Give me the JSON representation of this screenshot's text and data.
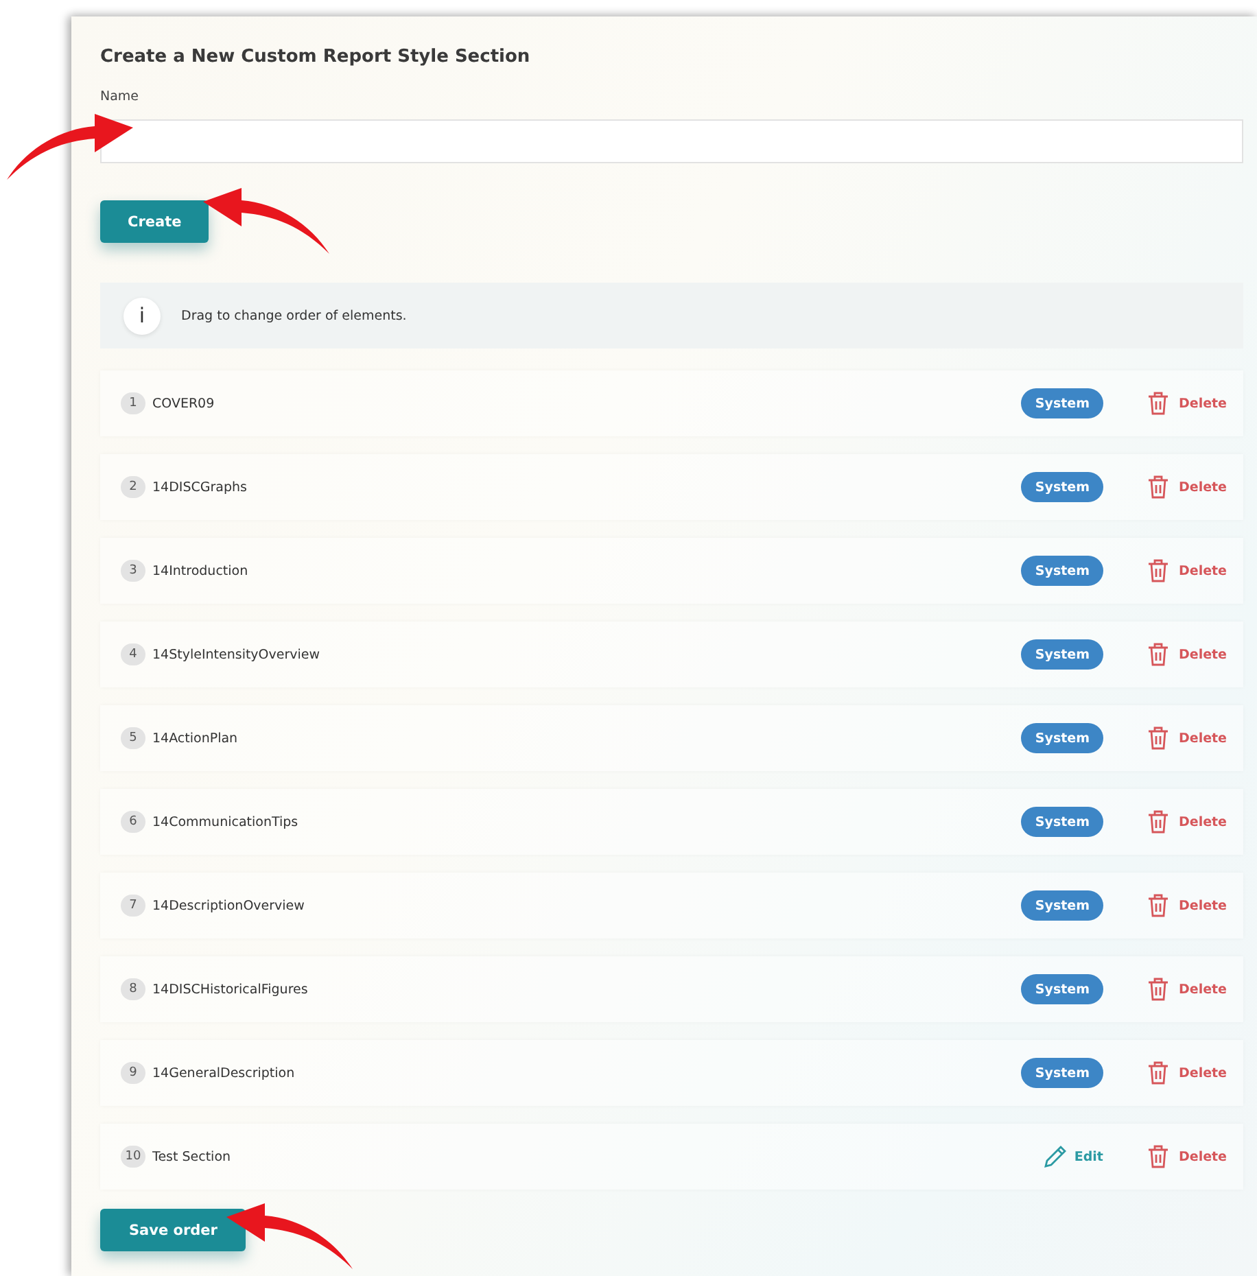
{
  "form": {
    "title": "Create a New Custom Report Style Section",
    "name_label": "Name",
    "create_button": "Create"
  },
  "info": {
    "icon": "i",
    "text": "Drag to change order of elements."
  },
  "sections": [
    {
      "number": "1",
      "name": "COVER09",
      "kind": "system",
      "tag": "System",
      "delete": "Delete"
    },
    {
      "number": "2",
      "name": "14DISCGraphs",
      "kind": "system",
      "tag": "System",
      "delete": "Delete"
    },
    {
      "number": "3",
      "name": "14Introduction",
      "kind": "system",
      "tag": "System",
      "delete": "Delete"
    },
    {
      "number": "4",
      "name": "14StyleIntensityOverview",
      "kind": "system",
      "tag": "System",
      "delete": "Delete"
    },
    {
      "number": "5",
      "name": "14ActionPlan",
      "kind": "system",
      "tag": "System",
      "delete": "Delete"
    },
    {
      "number": "6",
      "name": "14CommunicationTips",
      "kind": "system",
      "tag": "System",
      "delete": "Delete"
    },
    {
      "number": "7",
      "name": "14DescriptionOverview",
      "kind": "system",
      "tag": "System",
      "delete": "Delete"
    },
    {
      "number": "8",
      "name": "14DISCHistoricalFigures",
      "kind": "system",
      "tag": "System",
      "delete": "Delete"
    },
    {
      "number": "9",
      "name": "14GeneralDescription",
      "kind": "system",
      "tag": "System",
      "delete": "Delete"
    },
    {
      "number": "10",
      "name": "Test Section",
      "kind": "custom",
      "edit": "Edit",
      "delete": "Delete"
    }
  ],
  "save_button": "Save order"
}
